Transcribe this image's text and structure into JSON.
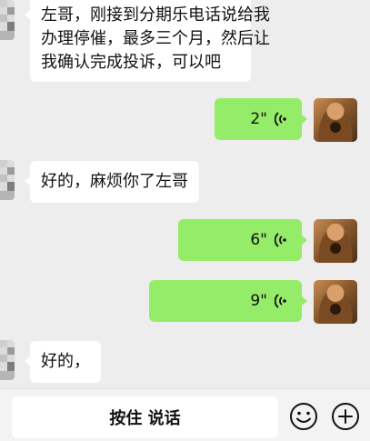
{
  "messages": [
    {
      "side": "left",
      "type": "text",
      "text": "左哥，刚接到分期乐电话说给我办理停催，最多三个月，然后让我确认完成投诉，可以吧"
    },
    {
      "side": "right",
      "type": "voice",
      "duration": "2\""
    },
    {
      "side": "left",
      "type": "text",
      "text": "好的，麻烦你了左哥"
    },
    {
      "side": "right",
      "type": "voice",
      "duration": "6\""
    },
    {
      "side": "right",
      "type": "voice",
      "duration": "9\""
    },
    {
      "side": "left",
      "type": "text",
      "text": "好的，"
    }
  ],
  "message1": {
    "line1": "左哥，刚接到分期乐电话说给我",
    "line2": "办理停催，最多三个月，然后让",
    "line3": "我确认完成投诉，可以吧"
  },
  "bottom_bar": {
    "hold_to_talk": "按住 说话"
  },
  "icons": [
    "emoji-icon",
    "plus-icon",
    "voice-wave-icon"
  ],
  "colors": {
    "background": "#ededed",
    "sent_bubble": "#95ec69",
    "received_bubble": "#ffffff"
  }
}
